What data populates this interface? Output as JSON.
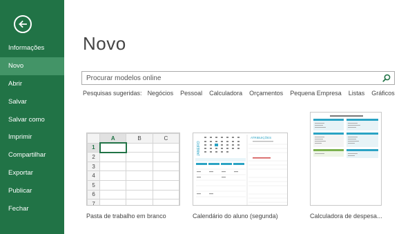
{
  "sidebar": {
    "back_label": "Voltar",
    "items": [
      {
        "label": "Informações",
        "active": false
      },
      {
        "label": "Novo",
        "active": true
      },
      {
        "label": "Abrir",
        "active": false
      },
      {
        "label": "Salvar",
        "active": false
      },
      {
        "label": "Salvar como",
        "active": false
      },
      {
        "label": "Imprimir",
        "active": false
      },
      {
        "label": "Compartilhar",
        "active": false
      },
      {
        "label": "Exportar",
        "active": false
      },
      {
        "label": "Publicar",
        "active": false
      },
      {
        "label": "Fechar",
        "active": false
      }
    ]
  },
  "main": {
    "title": "Novo",
    "search": {
      "placeholder": "Procurar modelos online",
      "value": ""
    },
    "suggested": {
      "label": "Pesquisas sugeridas:",
      "items": [
        "Negócios",
        "Pessoal",
        "Calculadora",
        "Orçamentos",
        "Pequena Empresa",
        "Listas",
        "Gráficos"
      ]
    },
    "templates": [
      {
        "label": "Pasta de trabalho em branco",
        "columns": [
          "A",
          "B",
          "C"
        ],
        "rows": [
          "1",
          "2",
          "3",
          "4",
          "5",
          "6",
          "7"
        ]
      },
      {
        "label": "Calendário do aluno (segunda)",
        "month": "JANEIRO",
        "heading": "ATRIBUIÇÕES"
      },
      {
        "label": "Calculadora de despesa..."
      }
    ]
  },
  "colors": {
    "sidebar": "#217346",
    "active": "#439467",
    "accent": "#217346"
  }
}
